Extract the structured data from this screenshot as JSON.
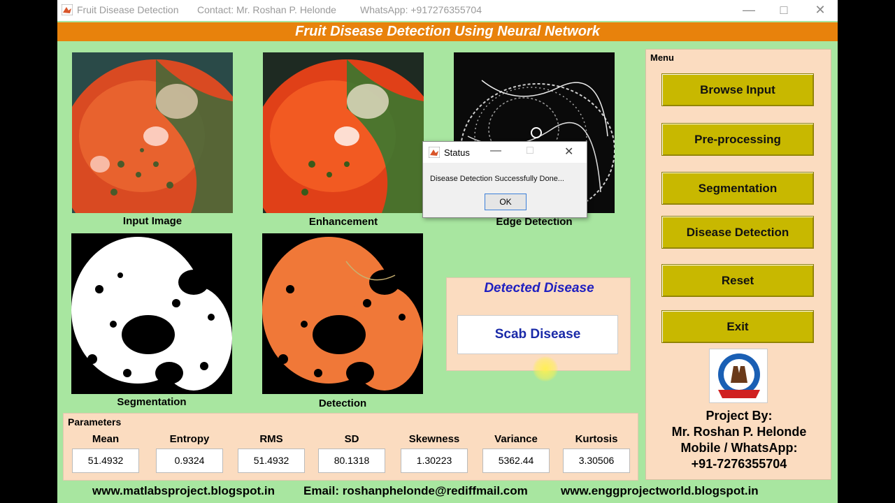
{
  "window": {
    "title": "Fruit Disease Detection",
    "contact": "Contact: Mr. Roshan P. Helonde",
    "whatsapp": "WhatsApp: +917276355704"
  },
  "banner": "Fruit Disease Detection Using Neural Network",
  "images": {
    "input_caption": "Input Image",
    "enhancement_caption": "Enhancement",
    "edge_caption": "Edge Detection",
    "segmentation_caption": "Segmentation",
    "detection_caption": "Detection"
  },
  "menu": {
    "title": "Menu",
    "buttons": [
      "Browse Input",
      "Pre-processing",
      "Segmentation",
      "Disease Detection",
      "Reset",
      "Exit"
    ],
    "project_by": "Project By:",
    "author": "Mr. Roshan P. Helonde",
    "mobile_label": "Mobile / WhatsApp:",
    "mobile": "+91-7276355704"
  },
  "detected": {
    "heading": "Detected Disease",
    "result": "Scab Disease"
  },
  "parameters": {
    "title": "Parameters",
    "items": [
      {
        "label": "Mean",
        "value": "51.4932"
      },
      {
        "label": "Entropy",
        "value": "0.9324"
      },
      {
        "label": "RMS",
        "value": "51.4932"
      },
      {
        "label": "SD",
        "value": "80.1318"
      },
      {
        "label": "Skewness",
        "value": "1.30223"
      },
      {
        "label": "Variance",
        "value": "5362.44"
      },
      {
        "label": "Kurtosis",
        "value": "3.30506"
      }
    ]
  },
  "footer": {
    "site1": "www.matlabsproject.blogspot.in",
    "email": "Email: roshanphelonde@rediffmail.com",
    "site2": "www.enggprojectworld.blogspot.in"
  },
  "dialog": {
    "title": "Status",
    "message": "Disease Detection Successfully Done...",
    "ok": "OK"
  },
  "colors": {
    "background": "#a8e6a0",
    "banner": "#e8820c",
    "button": "#c8b800",
    "panel": "#fbdcc0",
    "result_text": "#1a2aa8"
  }
}
